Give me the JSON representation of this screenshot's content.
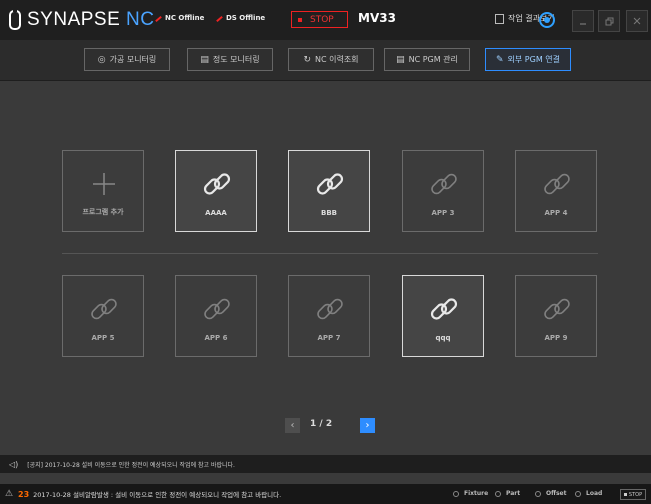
{
  "app": {
    "logo_text": "SYNAPSE",
    "logo_accent": "NC"
  },
  "status": {
    "nc": "NC Offline",
    "ds": "DS Offline"
  },
  "run_state": "STOP",
  "machine": "MV33",
  "header": {
    "result_view": "작업 결과보기"
  },
  "tabs": [
    {
      "label": "가공 모니터링",
      "icon": "monitor-icon"
    },
    {
      "label": "정도 모니터링",
      "icon": "table-icon"
    },
    {
      "label": "NC 이력조회",
      "icon": "history-icon"
    },
    {
      "label": "NC PGM 관리",
      "icon": "program-icon"
    },
    {
      "label": "외부 PGM 연결",
      "icon": "link-icon",
      "active": true
    }
  ],
  "tiles": [
    {
      "label": "프로그램 추가",
      "type": "add",
      "enabled": false
    },
    {
      "label": "AAAA",
      "type": "link",
      "enabled": true
    },
    {
      "label": "BBB",
      "type": "link",
      "enabled": true
    },
    {
      "label": "APP 3",
      "type": "link",
      "enabled": false
    },
    {
      "label": "APP 4",
      "type": "link",
      "enabled": false
    },
    {
      "label": "APP 5",
      "type": "link",
      "enabled": false
    },
    {
      "label": "APP 6",
      "type": "link",
      "enabled": false
    },
    {
      "label": "APP 7",
      "type": "link",
      "enabled": false
    },
    {
      "label": "qqq",
      "type": "link",
      "enabled": true
    },
    {
      "label": "APP 9",
      "type": "link",
      "enabled": false
    }
  ],
  "pagination": {
    "current": "1 / 2"
  },
  "notice": "[공지] 2017-10-28 설비 이동으로 인한 정전이 예상되오니 작업에 참고 바랍니다.",
  "alarm": {
    "count": "23",
    "message": "2017-10-28 설비알람발생 : 설비 이동으로 인한 정전이 예상되오니 작업에 참고 바랍니다."
  },
  "bottom_status": {
    "fixture": "Fixture",
    "part": "Part",
    "offset": "Offset",
    "load": "Load",
    "stop": "STOP"
  },
  "colors": {
    "accent": "#2e8dff",
    "stop": "#e22222",
    "alarm": "#ff6a00"
  }
}
